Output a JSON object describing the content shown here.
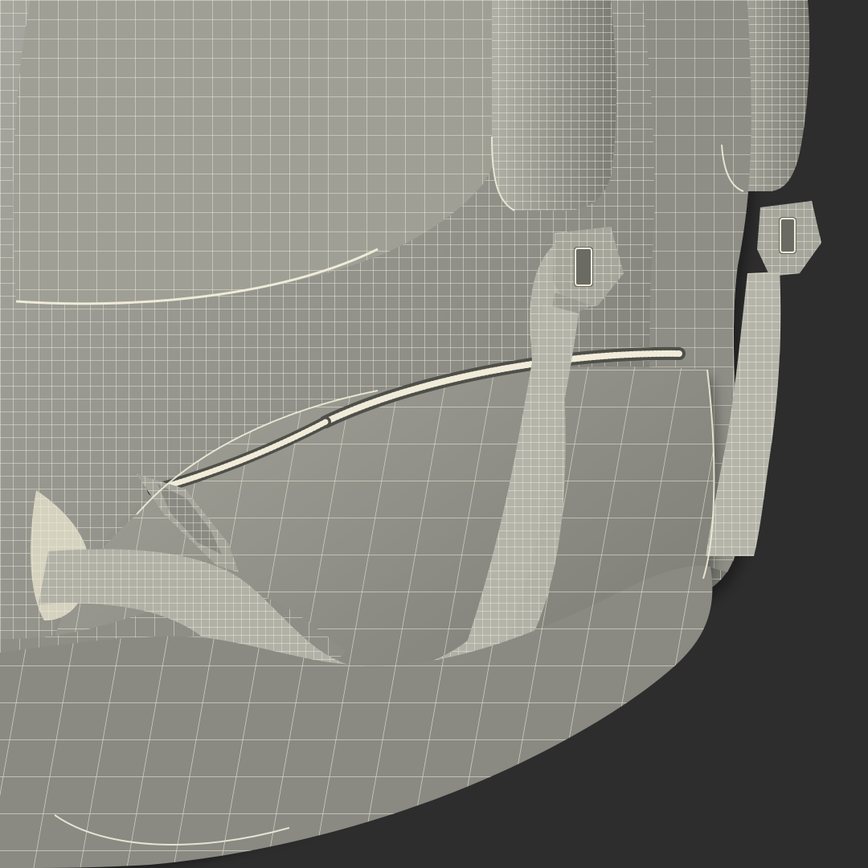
{
  "scene": {
    "subject": "backpack-wireframe-render",
    "colors": {
      "background": "#2d2d2d",
      "surface": "#8d8d85",
      "surface_light": "#a3a39a",
      "surface_dark": "#6f6f68",
      "wire": "#f1ecd9",
      "shadow": "#1f1f1f"
    }
  }
}
